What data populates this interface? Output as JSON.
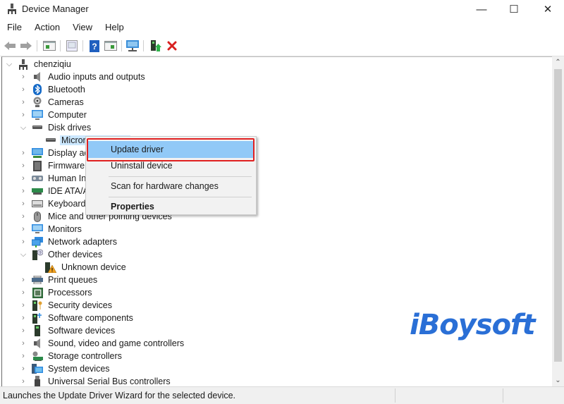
{
  "window": {
    "title": "Device Manager",
    "controls": {
      "minimize": "—",
      "maximize": "☐",
      "close": "✕"
    }
  },
  "menubar": {
    "items": [
      {
        "label": "File"
      },
      {
        "label": "Action"
      },
      {
        "label": "View"
      },
      {
        "label": "Help"
      }
    ]
  },
  "toolbar": {
    "buttons": [
      {
        "icon": "back-arrow-icon"
      },
      {
        "icon": "forward-arrow-icon"
      },
      {
        "icon": "show-hide-console-tree-icon"
      },
      {
        "icon": "properties-icon"
      },
      {
        "icon": "help-icon"
      },
      {
        "icon": "show-hide-action-pane-icon"
      },
      {
        "icon": "scan-hardware-icon"
      },
      {
        "icon": "update-driver-icon"
      },
      {
        "icon": "uninstall-device-icon"
      }
    ]
  },
  "tree": {
    "root": {
      "label": "chenziqiu",
      "expanded": true
    },
    "items": [
      {
        "label": "Audio inputs and outputs",
        "icon": "speaker-icon",
        "expanded": false
      },
      {
        "label": "Bluetooth",
        "icon": "bluetooth-icon",
        "expanded": false
      },
      {
        "label": "Cameras",
        "icon": "webcam-icon",
        "expanded": false
      },
      {
        "label": "Computer",
        "icon": "computer-monitor-icon",
        "expanded": false
      },
      {
        "label": "Disk drives",
        "icon": "disk-drive-icon",
        "expanded": true
      },
      {
        "label": "Micron",
        "icon": "disk-drive-icon",
        "child": true,
        "selected": true
      },
      {
        "label": "Display ad",
        "icon": "display-adapter-icon",
        "expanded": false
      },
      {
        "label": "Firmware",
        "icon": "firmware-icon",
        "expanded": false
      },
      {
        "label": "Human In",
        "icon": "hid-icon",
        "expanded": false
      },
      {
        "label": "IDE ATA/A",
        "icon": "ide-controller-icon",
        "expanded": false
      },
      {
        "label": "Keyboards",
        "icon": "keyboard-icon",
        "expanded": false
      },
      {
        "label": "Mice and other pointing devices",
        "icon": "mouse-icon",
        "expanded": false
      },
      {
        "label": "Monitors",
        "icon": "monitor-icon",
        "expanded": false
      },
      {
        "label": "Network adapters",
        "icon": "network-adapter-icon",
        "expanded": false
      },
      {
        "label": "Other devices",
        "icon": "other-devices-icon",
        "expanded": true
      },
      {
        "label": "Unknown device",
        "icon": "unknown-device-warning-icon",
        "child": true
      },
      {
        "label": "Print queues",
        "icon": "printer-icon",
        "expanded": false
      },
      {
        "label": "Processors",
        "icon": "processor-icon",
        "expanded": false
      },
      {
        "label": "Security devices",
        "icon": "security-device-icon",
        "expanded": false
      },
      {
        "label": "Software components",
        "icon": "software-component-icon",
        "expanded": false
      },
      {
        "label": "Software devices",
        "icon": "software-device-icon",
        "expanded": false
      },
      {
        "label": "Sound, video and game controllers",
        "icon": "speaker-icon",
        "expanded": false
      },
      {
        "label": "Storage controllers",
        "icon": "storage-controller-icon",
        "expanded": false
      },
      {
        "label": "System devices",
        "icon": "system-devices-icon",
        "expanded": false
      },
      {
        "label": "Universal Serial Bus controllers",
        "icon": "usb-icon",
        "expanded": false
      }
    ]
  },
  "context_menu": {
    "items": [
      {
        "label": "Update driver",
        "highlighted": true,
        "bold": false
      },
      {
        "label": "Uninstall device",
        "highlighted": false,
        "bold": false
      },
      {
        "separator": true
      },
      {
        "label": "Scan for hardware changes",
        "highlighted": false,
        "bold": false
      },
      {
        "separator": true
      },
      {
        "label": "Properties",
        "highlighted": false,
        "bold": true
      }
    ],
    "annotation_color": "#e02020"
  },
  "watermark": {
    "text": "iBoysoft",
    "color": "#2a6fd6"
  },
  "statusbar": {
    "text": "Launches the Update Driver Wizard for the selected device."
  }
}
